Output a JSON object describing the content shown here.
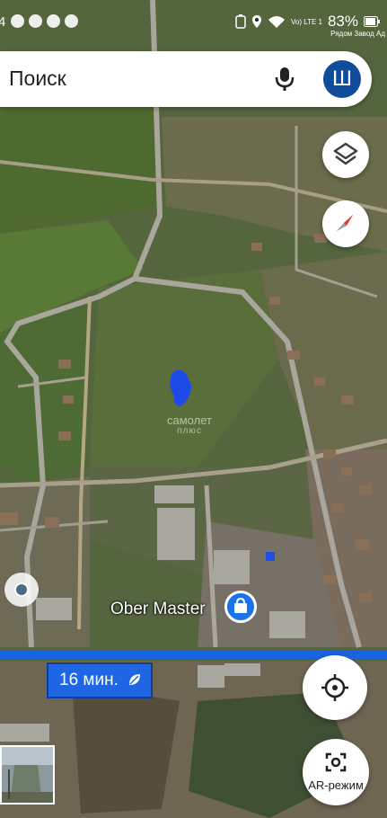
{
  "status_bar": {
    "time": "4",
    "battery_percent": "83%",
    "sub_text": "Рядом Завод Ад",
    "network": "Vo) LTE 1"
  },
  "search": {
    "placeholder": "Поиск",
    "avatar_letter": "Ш"
  },
  "map": {
    "watermark_line1": "самолет",
    "watermark_line2": "плюс",
    "poi_name": "Ober Master",
    "eta": "16 мин.",
    "ar_mode_label": "AR-режим"
  },
  "colors": {
    "accent_blue": "#1a73e8",
    "route_blue": "#1a63e0",
    "avatar_bg": "#0f4c99",
    "compass_red": "#e53935"
  },
  "icons": [
    "mic-icon",
    "layers-icon",
    "compass-icon",
    "my-location-icon",
    "ar-camera-icon",
    "leaf-icon",
    "shopping-bag-icon"
  ]
}
